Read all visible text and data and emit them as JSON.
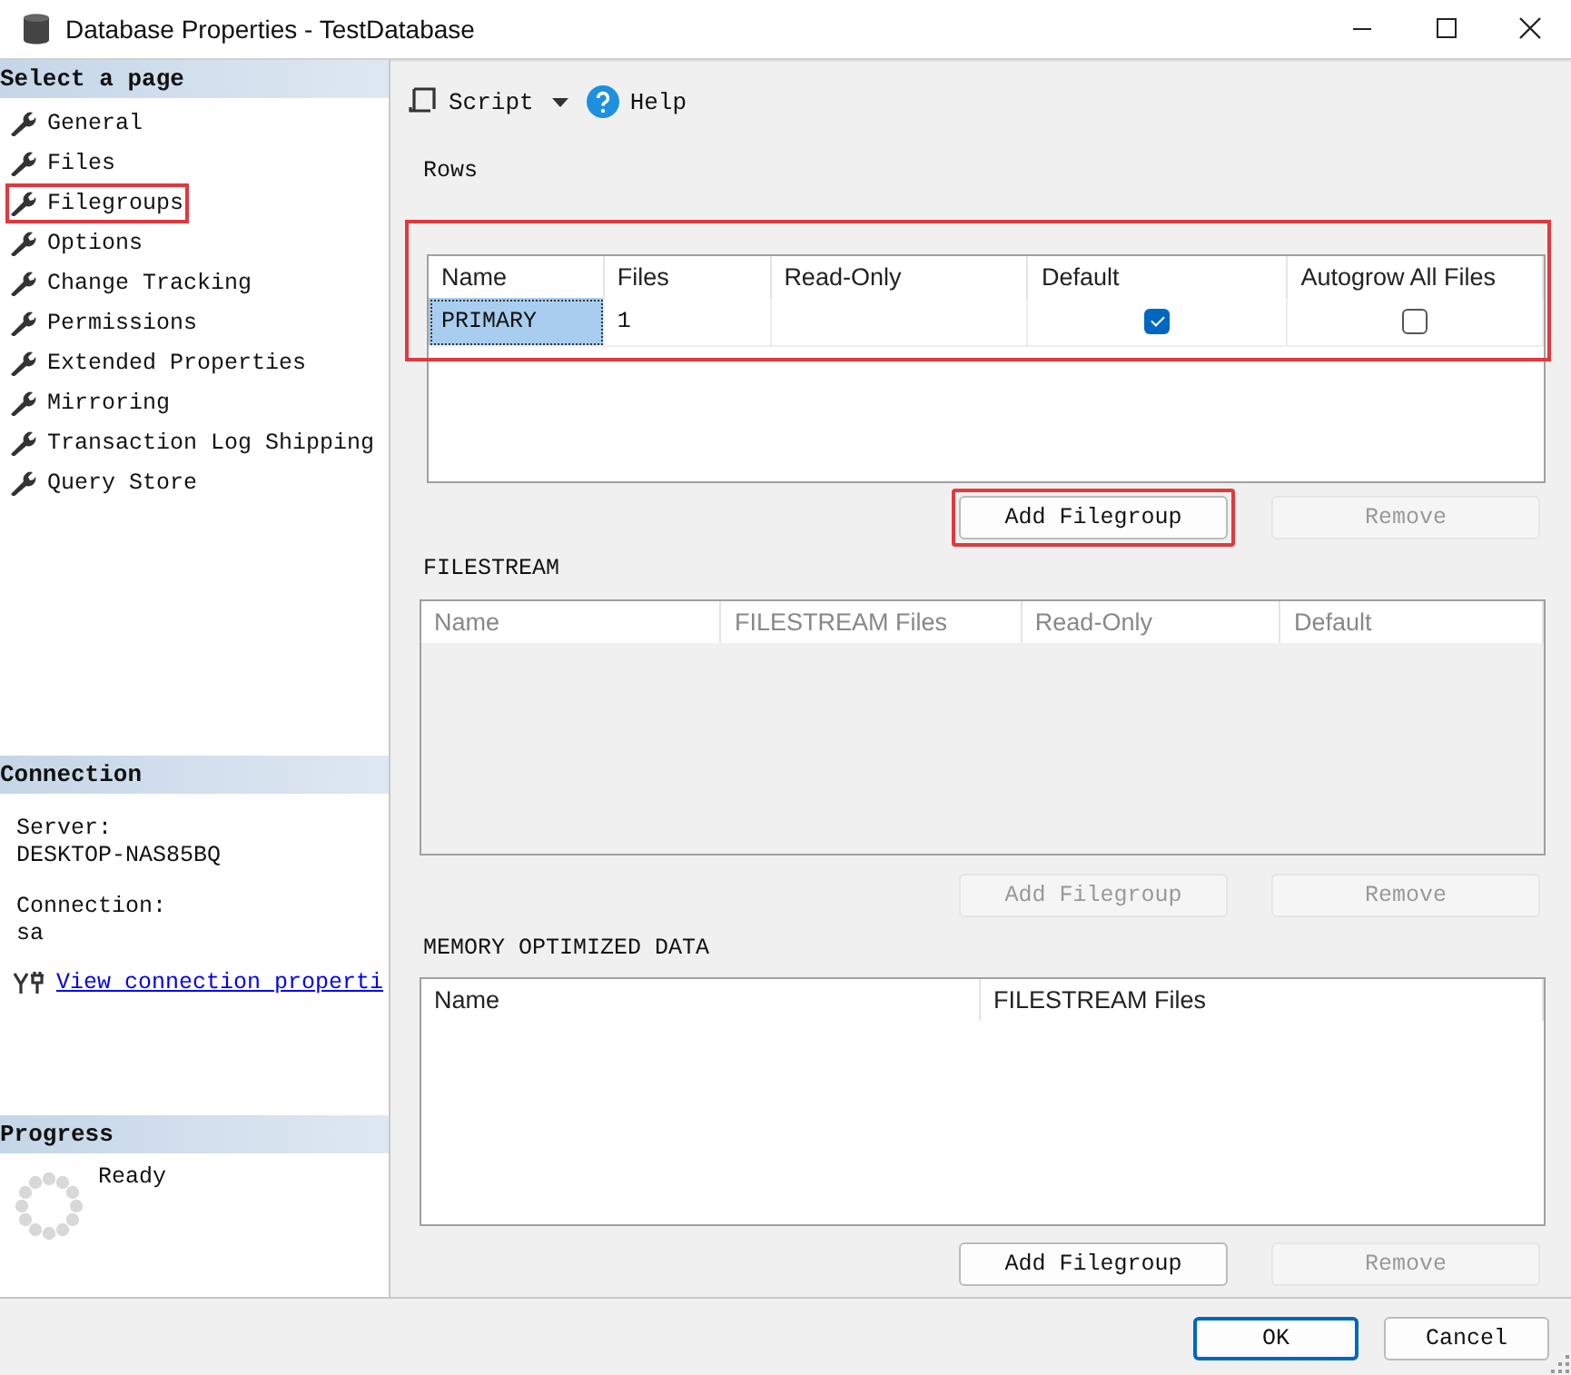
{
  "window": {
    "title": "Database Properties - TestDatabase"
  },
  "sidebar": {
    "header": "Select a page",
    "pages": [
      {
        "label": "General",
        "highlighted": false
      },
      {
        "label": "Files",
        "highlighted": false
      },
      {
        "label": "Filegroups",
        "highlighted": true
      },
      {
        "label": "Options",
        "highlighted": false
      },
      {
        "label": "Change Tracking",
        "highlighted": false
      },
      {
        "label": "Permissions",
        "highlighted": false
      },
      {
        "label": "Extended Properties",
        "highlighted": false
      },
      {
        "label": "Mirroring",
        "highlighted": false
      },
      {
        "label": "Transaction Log Shipping",
        "highlighted": false
      },
      {
        "label": "Query Store",
        "highlighted": false
      }
    ],
    "connection": {
      "header": "Connection",
      "server_label": "Server:",
      "server": "DESKTOP-NAS85BQ",
      "connection_label": "Connection:",
      "connection": "sa",
      "link": "View connection properti"
    },
    "progress": {
      "header": "Progress",
      "status": "Ready"
    }
  },
  "toolbar": [
    {
      "kind": "script",
      "label": "Script"
    },
    {
      "kind": "help",
      "label": "Help"
    }
  ],
  "sections": [
    {
      "title": "Rows",
      "enabled": true,
      "highlighted": true,
      "columns": [
        "Name",
        "Files",
        "Read-Only",
        "Default",
        "Autogrow All Files"
      ],
      "rows": [
        {
          "cells": [
            {
              "kind": "text",
              "text": "PRIMARY",
              "selected": true
            },
            {
              "kind": "text",
              "text": "1",
              "selected": false
            },
            {
              "kind": "empty"
            },
            {
              "kind": "checkbox",
              "checked": true
            },
            {
              "kind": "checkbox",
              "checked": false
            }
          ]
        }
      ],
      "buttons": [
        {
          "label": "Add Filegroup",
          "disabled": false,
          "highlighted": true
        },
        {
          "label": "Remove",
          "disabled": true,
          "highlighted": false
        }
      ]
    },
    {
      "title": "FILESTREAM",
      "enabled": false,
      "highlighted": false,
      "columns": [
        "Name",
        "FILESTREAM Files",
        "Read-Only",
        "Default"
      ],
      "buttons": [
        {
          "label": "Add Filegroup",
          "disabled": true,
          "highlighted": false
        },
        {
          "label": "Remove",
          "disabled": true,
          "highlighted": false
        }
      ]
    },
    {
      "title": "MEMORY OPTIMIZED DATA",
      "enabled": true,
      "highlighted": false,
      "columns": [
        "Name",
        "FILESTREAM Files"
      ],
      "buttons": [
        {
          "label": "Add Filegroup",
          "disabled": false,
          "highlighted": false
        },
        {
          "label": "Remove",
          "disabled": true,
          "highlighted": false
        }
      ]
    }
  ],
  "footer": {
    "buttons": [
      {
        "label": "OK",
        "default": true
      },
      {
        "label": "Cancel",
        "default": false
      }
    ]
  }
}
